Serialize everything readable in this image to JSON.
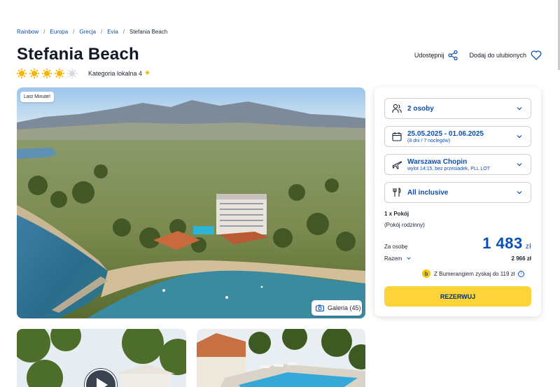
{
  "breadcrumb": {
    "items": [
      "Rainbow",
      "Europa",
      "Grecja",
      "Evia"
    ],
    "current": "Stefania Beach",
    "sep": "/"
  },
  "hotel": {
    "name": "Stefania Beach",
    "stars_filled": 4,
    "stars_total": 5,
    "local_category": "Kategoria lokalna 4",
    "local_category_star": "★"
  },
  "actions": {
    "share": "Udostępnij",
    "favorite": "Dodaj do ulubionych"
  },
  "gallery": {
    "badge": "Last Minute!",
    "button": "Galeria (45)"
  },
  "booking": {
    "persons": "2 osoby",
    "dates": "25.05.2025 - 01.06.2025",
    "dates_sub": "(8 dni / 7 noclegów)",
    "departure": "Warszawa Chopin",
    "departure_sub": "wylot 14:15, bez przesiadek, PLL LOT",
    "board": "All inclusive",
    "room_count": "1 x Pokój",
    "room_type": "(Pokój rodzinny)",
    "per_person_label": "Za osobę",
    "per_person_price": "1 483",
    "currency": "zł",
    "total_label": "Razem",
    "total_value": "2 966 zł",
    "boomerang_icon": "b",
    "boomerang": "Z Bumerangiem zyskaj do 119 zł",
    "info_icon": "i",
    "reserve": "REZERWUJ"
  },
  "colors": {
    "accent": "#0a4fb3",
    "star": "#f7b500",
    "button": "#fcd43a"
  }
}
